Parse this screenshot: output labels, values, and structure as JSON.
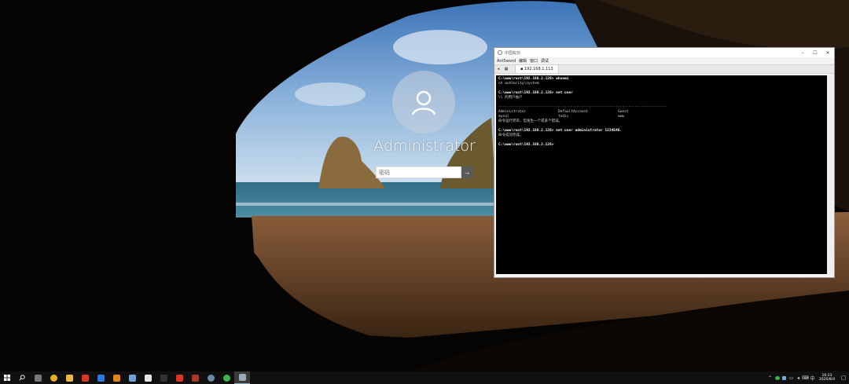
{
  "login": {
    "username": "Administrator",
    "password_placeholder": "密码",
    "submit_icon": "arrow-right-icon"
  },
  "antsword": {
    "title": "中国蚁剑",
    "menu": [
      "AntSword",
      "编辑",
      "窗口",
      "调试"
    ],
    "tab_label": "192.168.1.113",
    "win_buttons": [
      "–",
      "☐",
      "✕"
    ],
    "terminal": {
      "prompt1": "C:\\www\\root\\192.168.2.128> whoami",
      "out1": "nt authority\\system",
      "prompt2": "C:\\www\\root\\192.168.2.128> net user",
      "out2": "\\\\ 的用户帐户",
      "separator": "-------------------------------------------------------------------------------",
      "users_row1": [
        "Administrator",
        "DefaultAccount",
        "Guest"
      ],
      "users_row2": [
        "mysql",
        "todic",
        "www"
      ],
      "out3": "命令运行完毕，但发生一个或多个错误。",
      "prompt3": "C:\\www\\root\\192.168.2.128> net user administrator 1234546.",
      "out4": "命令成功完成。",
      "prompt4": "C:\\www\\root\\192.168.2.128>"
    }
  },
  "taskbar": {
    "start_icon": "windows-start-icon",
    "search_icon": "search-icon",
    "apps": [
      {
        "name": "task-view-icon",
        "color": "#777777"
      },
      {
        "name": "chrome-icon",
        "color": "#e8b020"
      },
      {
        "name": "file-explorer-icon",
        "color": "#e9b845"
      },
      {
        "name": "app-red-icon",
        "color": "#d43a2a"
      },
      {
        "name": "app-blue-icon",
        "color": "#2f7ad8"
      },
      {
        "name": "app-orange-icon",
        "color": "#e0841c"
      },
      {
        "name": "notepad-icon",
        "color": "#6fa3d8"
      },
      {
        "name": "document-icon",
        "color": "#e6e6e6"
      },
      {
        "name": "terminal-icon",
        "color": "#333333"
      },
      {
        "name": "app-rounded-red-icon",
        "color": "#d9342b"
      },
      {
        "name": "app-dark-red-icon",
        "color": "#a83828"
      },
      {
        "name": "app-globe-icon",
        "color": "#6a8aa8"
      },
      {
        "name": "wechat-icon",
        "color": "#3fb34f"
      },
      {
        "name": "antsword-icon",
        "color": "#9aa8b8"
      }
    ],
    "clock_time": "16:23",
    "clock_date": "2020/8/4",
    "tray_icons": [
      "chevron-up-icon",
      "wechat-tray-icon",
      "app-tray-icon",
      "network-icon",
      "volume-icon",
      "keyboard-icon",
      "ime-icon"
    ]
  }
}
